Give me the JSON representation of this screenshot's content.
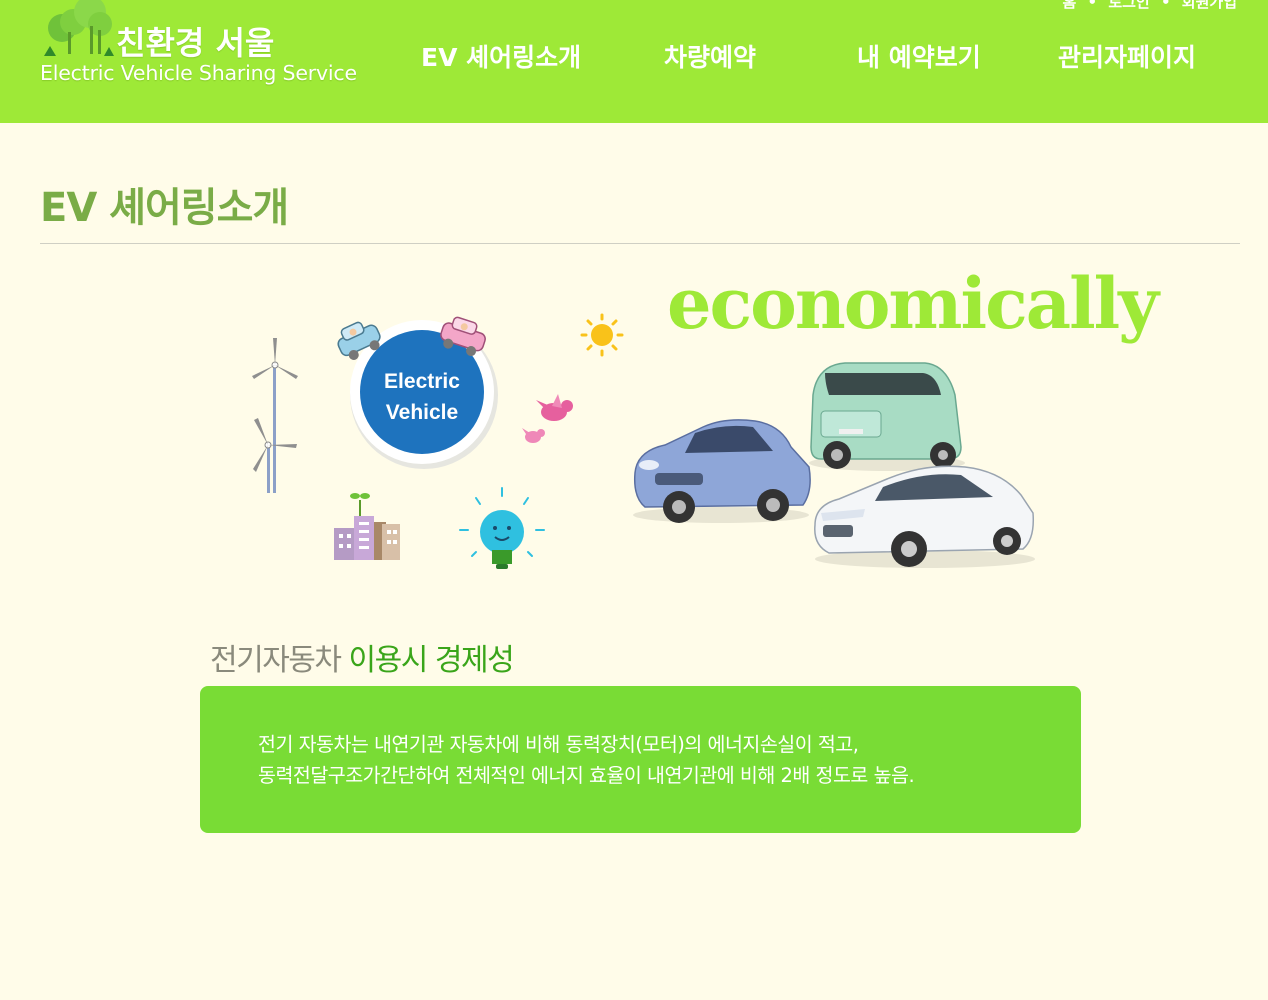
{
  "header": {
    "util_links": [
      "홈",
      "로그인",
      "회원가입"
    ],
    "util_separator": "•",
    "logo_title": "친환경 서울",
    "logo_subtitle": "Electric Vehicle Sharing Service",
    "nav": [
      {
        "label": "EV 셰어링소개"
      },
      {
        "label": "차량예약"
      },
      {
        "label": "내 예약보기"
      },
      {
        "label": "관리자페이지"
      }
    ]
  },
  "main": {
    "page_title": "EV 셰어링소개",
    "hero": {
      "badge_line1": "Electric",
      "badge_line2": "Vehicle",
      "headline": "economically"
    },
    "section": {
      "title_part1": "전기자동차",
      "title_part2": " 이용시 경제성",
      "lines": [
        "전기 자동차는 내연기관 자동차에 비해 동력장치(모터)의 에너지손실이 적고,",
        "동력전달구조가간단하여 전체적인 에너지 효율이 내연기관에 비해 2배 정도로 높음."
      ]
    }
  },
  "colors": {
    "header_bg": "#9ee937",
    "page_bg": "#fffce9",
    "title_green": "#7aac47",
    "box_green": "#79dc35",
    "badge_blue": "#1e73be"
  },
  "icons": [
    "tree-logo-icon",
    "wind-turbine-icon",
    "car-icon",
    "sun-icon",
    "bird-icon",
    "building-icon",
    "lightbulb-icon",
    "electric-car-icon"
  ]
}
